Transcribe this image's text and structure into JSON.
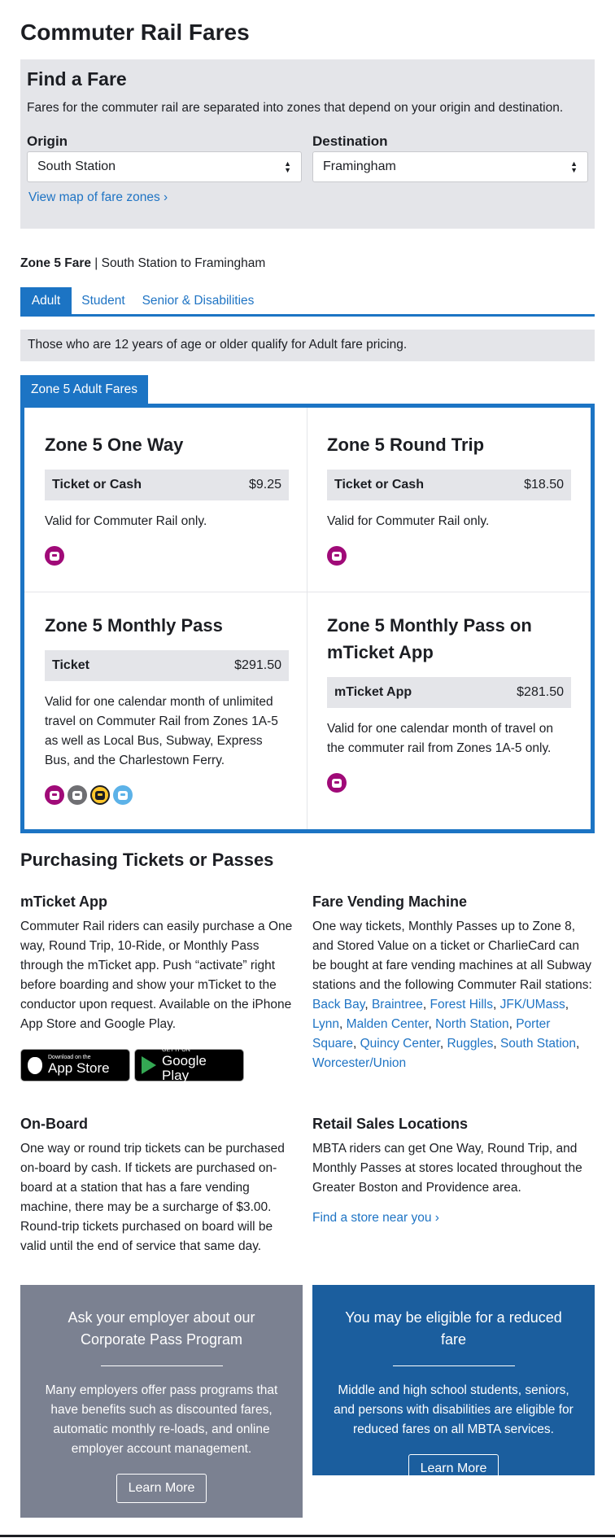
{
  "page_title": "Commuter Rail Fares",
  "find_fare": {
    "title": "Find a Fare",
    "description": "Fares for the commuter rail are separated into zones that depend on your origin and destination.",
    "origin_label": "Origin",
    "origin_value": "South Station",
    "destination_label": "Destination",
    "destination_value": "Framingham",
    "map_link": "View map of fare zones ›"
  },
  "zone_summary": {
    "fare": "Zone 5 Fare",
    "route": " | South Station to Framingham"
  },
  "tabs": [
    "Adult",
    "Student",
    "Senior & Disabilities"
  ],
  "age_note": "Those who are 12 years of age or older qualify for Adult fare pricing.",
  "fares_tab_label": "Zone 5 Adult Fares",
  "cards": [
    {
      "title": "Zone 5 One Way",
      "ptype": "Ticket or Cash",
      "price": "$9.25",
      "valid": "Valid for Commuter Rail only."
    },
    {
      "title": "Zone 5 Round Trip",
      "ptype": "Ticket or Cash",
      "price": "$18.50",
      "valid": "Valid for Commuter Rail only."
    },
    {
      "title": "Zone 5 Monthly Pass",
      "ptype": "Ticket",
      "price": "$291.50",
      "valid": "Valid for one calendar month of unlimited travel on Commuter Rail from Zones 1A-5 as well as Local Bus, Subway, Express Bus, and the Charlestown Ferry."
    },
    {
      "title": "Zone 5 Monthly Pass on mTicket App",
      "ptype": "mTicket App",
      "price": "$281.50",
      "valid": "Valid for one calendar month of travel on the commuter rail from Zones 1A-5 only."
    }
  ],
  "colors": {
    "accent": "#1c74c4",
    "commuter_rail": "#a00a78",
    "bus": "#6f6f73",
    "subway": "#ffc72c",
    "ferry": "#5cb2e8"
  },
  "purchase": {
    "title": "Purchasing Tickets or Passes",
    "mticket_title": "mTicket App",
    "mticket_text": "Commuter Rail riders can easily purchase a One way, Round Trip, 10-Ride, or Monthly Pass through the mTicket app. Push “activate” right before boarding and show your mTicket to the conductor upon request. Available on the iPhone App Store and Google Play.",
    "appstore_small": "Download on the",
    "appstore_big": "App Store",
    "googleplay_small": "GET IT ON",
    "googleplay_big": "Google Play",
    "fvm_title": "Fare Vending Machine",
    "fvm_text": "One way tickets, Monthly Passes up to Zone 8, and Stored Value on a ticket or CharlieCard can be bought at fare vending machines at all Subway stations and the following Commuter Rail stations: ",
    "fvm_stations": [
      "Back Bay",
      "Braintree",
      "Forest Hills",
      "JFK/UMass",
      "Lynn",
      "Malden Center",
      "North Station",
      "Porter Square",
      "Quincy Center",
      "Ruggles",
      "South Station",
      "Worcester/Union"
    ],
    "onboard_title": "On-Board",
    "onboard_text": "One way or round trip tickets can be purchased on-board by cash. If tickets are purchased on-board at a station that has a fare vending machine, there may be a surcharge of $3.00. Round-trip tickets purchased on board will be valid until the end of service that same day.",
    "retail_title": "Retail Sales Locations",
    "retail_text": "MBTA riders can get One Way, Round Trip, and Monthly Passes at stores located throughout the Greater Boston and Providence area.",
    "retail_link": "Find a store near you ›"
  },
  "promos": [
    {
      "title": "Ask your employer about our Corporate Pass Program",
      "text": "Many employers offer pass programs that have benefits such as discounted fares, automatic monthly re-loads, and online employer account management.",
      "button": "Learn More",
      "bg": "#7b8191"
    },
    {
      "title": "You may be eligible for a reduced fare",
      "text": "Middle and high school students, seniors, and persons with disabilities are eligible for reduced fares on all MBTA services.",
      "button": "Learn More",
      "bg": "#1b5e9e"
    }
  ]
}
